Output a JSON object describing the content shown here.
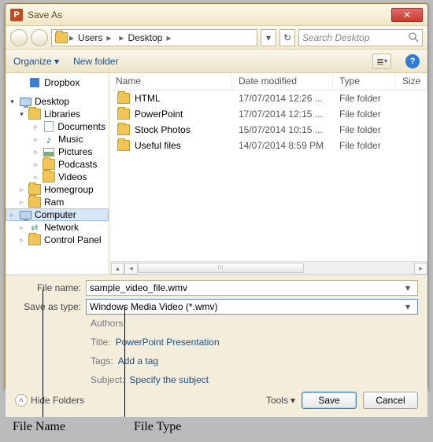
{
  "window": {
    "title": "Save As",
    "app_icon_letter": "P",
    "close_glyph": "✕"
  },
  "nav": {
    "path": [
      "Users",
      "",
      "Desktop"
    ],
    "refresh_glyph": "↻",
    "dropdown_glyph": "▾",
    "search_placeholder": "Search Desktop"
  },
  "toolbar": {
    "organize": "Organize",
    "new_folder": "New folder",
    "view_glyph": "≣",
    "help_glyph": "?"
  },
  "tree": {
    "items": [
      {
        "label": "Dropbox",
        "indent": 1,
        "icon": "blue-cube",
        "tri": ""
      },
      {
        "label": "",
        "indent": 0,
        "spacer": true
      },
      {
        "label": "Desktop",
        "indent": 0,
        "icon": "monitor",
        "tri": "▾"
      },
      {
        "label": "Libraries",
        "indent": 1,
        "icon": "folder",
        "tri": "▾"
      },
      {
        "label": "Documents",
        "indent": 2,
        "icon": "doc",
        "tri": "▹"
      },
      {
        "label": "Music",
        "indent": 2,
        "icon": "music",
        "tri": "▹"
      },
      {
        "label": "Pictures",
        "indent": 2,
        "icon": "pic",
        "tri": "▹"
      },
      {
        "label": "Podcasts",
        "indent": 2,
        "icon": "folder",
        "tri": "▹"
      },
      {
        "label": "Videos",
        "indent": 2,
        "icon": "folder",
        "tri": "▹"
      },
      {
        "label": "Homegroup",
        "indent": 1,
        "icon": "folder",
        "tri": "▹"
      },
      {
        "label": "Ram",
        "indent": 1,
        "icon": "folder",
        "tri": "▹"
      },
      {
        "label": "Computer",
        "indent": 1,
        "icon": "monitor",
        "tri": "▹",
        "selected": true
      },
      {
        "label": "Network",
        "indent": 1,
        "icon": "net",
        "tri": "▹"
      },
      {
        "label": "Control Panel",
        "indent": 1,
        "icon": "folder",
        "tri": "▹"
      }
    ]
  },
  "columns": {
    "name": "Name",
    "date": "Date modified",
    "type": "Type",
    "size": "Size"
  },
  "rows": [
    {
      "name": "HTML",
      "date": "17/07/2014 12:26 ...",
      "type": "File folder"
    },
    {
      "name": "PowerPoint",
      "date": "17/07/2014 12:15 ...",
      "type": "File folder"
    },
    {
      "name": "Stock Photos",
      "date": "15/07/2014 10:15 ...",
      "type": "File folder"
    },
    {
      "name": "Useful files",
      "date": "14/07/2014 8:59 PM",
      "type": "File folder"
    }
  ],
  "form": {
    "file_name_label": "File name:",
    "file_name_value": "sample_video_file.wmv",
    "save_type_label": "Save as type:",
    "save_type_value": "Windows Media Video (*.wmv)",
    "authors_label": "Authors:",
    "authors_value": "",
    "tags_label": "Tags:",
    "tags_value": "Add a tag",
    "title_label": "Title:",
    "title_value": "PowerPoint Presentation",
    "subject_label": "Subject:",
    "subject_value": "Specify the subject"
  },
  "footer": {
    "hide_folders": "Hide Folders",
    "tools": "Tools",
    "save": "Save",
    "cancel": "Cancel"
  },
  "annotations": {
    "file_name": "File Name",
    "file_type": "File Type"
  }
}
